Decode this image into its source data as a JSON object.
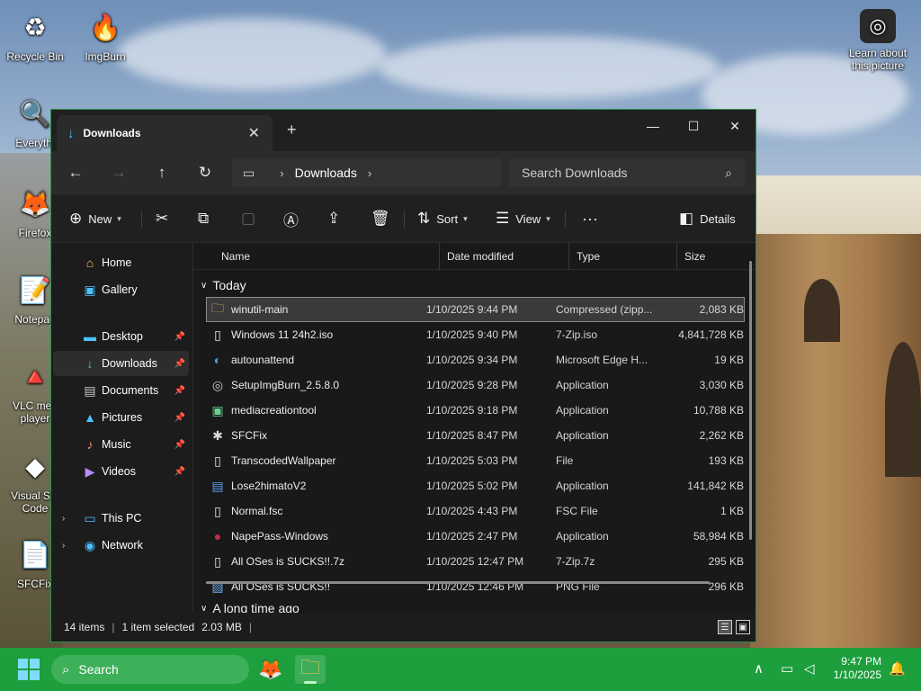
{
  "desktop": {
    "icons": [
      {
        "label": "Recycle Bin",
        "glyph": "♻"
      },
      {
        "label": "ImgBurn",
        "glyph": "🔥"
      },
      {
        "label": "Everythi",
        "glyph": "🔍"
      },
      {
        "label": "Firefox",
        "glyph": "🦊"
      },
      {
        "label": "Notepad",
        "glyph": "📝"
      },
      {
        "label": "VLC med player",
        "glyph": "🔺"
      },
      {
        "label": "Visual Stu Code",
        "glyph": "◆"
      },
      {
        "label": "SFCFix",
        "glyph": "📄"
      }
    ],
    "spotlight_label": "Learn about this picture"
  },
  "window": {
    "tab_title": "Downloads",
    "address": {
      "crumb": "Downloads"
    },
    "search_placeholder": "Search Downloads",
    "commands": {
      "new": "New",
      "sort": "Sort",
      "view": "View",
      "more": "···",
      "details": "Details"
    },
    "sidebar": {
      "top": [
        {
          "label": "Home",
          "glyph": "⌂",
          "color": "#f0c46a"
        },
        {
          "label": "Gallery",
          "glyph": "▣",
          "color": "#4cc2ff"
        }
      ],
      "pinned": [
        {
          "label": "Desktop",
          "glyph": "▬",
          "color": "#4cc2ff"
        },
        {
          "label": "Downloads",
          "glyph": "↓",
          "color": "#57d08a"
        },
        {
          "label": "Documents",
          "glyph": "▤",
          "color": "#c9c9c9"
        },
        {
          "label": "Pictures",
          "glyph": "▲",
          "color": "#4cc2ff"
        },
        {
          "label": "Music",
          "glyph": "♪",
          "color": "#ff8c6a"
        },
        {
          "label": "Videos",
          "glyph": "▶",
          "color": "#b58cff"
        }
      ],
      "bottom": [
        {
          "label": "This PC",
          "glyph": "▭",
          "color": "#4cc2ff"
        },
        {
          "label": "Network",
          "glyph": "◉",
          "color": "#4cc2ff"
        }
      ]
    },
    "columns": {
      "name": "Name",
      "date": "Date modified",
      "type": "Type",
      "size": "Size"
    },
    "group_today": "Today",
    "group_old": "A long time ago",
    "files": [
      {
        "name": "winutil-main",
        "date": "1/10/2025 9:44 PM",
        "type": "Compressed (zipp...",
        "size": "2,083 KB",
        "glyph": "🗀",
        "color": "#f3c75a",
        "selected": true
      },
      {
        "name": "Windows 11 24h2.iso",
        "date": "1/10/2025 9:40 PM",
        "type": "7-Zip.iso",
        "size": "4,841,728 KB",
        "glyph": "▯",
        "color": "#e8e8e8"
      },
      {
        "name": "autounattend",
        "date": "1/10/2025 9:34 PM",
        "type": "Microsoft Edge H...",
        "size": "19 KB",
        "glyph": "◐",
        "color": "#36a3e8"
      },
      {
        "name": "SetupImgBurn_2.5.8.0",
        "date": "1/10/2025 9:28 PM",
        "type": "Application",
        "size": "3,030 KB",
        "glyph": "◎",
        "color": "#c9c9c9"
      },
      {
        "name": "mediacreationtool",
        "date": "1/10/2025 9:18 PM",
        "type": "Application",
        "size": "10,788 KB",
        "glyph": "▣",
        "color": "#6ad08c"
      },
      {
        "name": "SFCFix",
        "date": "1/10/2025 8:47 PM",
        "type": "Application",
        "size": "2,262 KB",
        "glyph": "✱",
        "color": "#dcdcdc"
      },
      {
        "name": "TranscodedWallpaper",
        "date": "1/10/2025 5:03 PM",
        "type": "File",
        "size": "193 KB",
        "glyph": "▯",
        "color": "#e8e8e8"
      },
      {
        "name": "Lose2himatoV2",
        "date": "1/10/2025 5:02 PM",
        "type": "Application",
        "size": "141,842 KB",
        "glyph": "▤",
        "color": "#5aa0e8"
      },
      {
        "name": "Normal.fsc",
        "date": "1/10/2025 4:43 PM",
        "type": "FSC File",
        "size": "1 KB",
        "glyph": "▯",
        "color": "#e8e8e8"
      },
      {
        "name": "NapePass-Windows",
        "date": "1/10/2025 2:47 PM",
        "type": "Application",
        "size": "58,984 KB",
        "glyph": "●",
        "color": "#c0304a"
      },
      {
        "name": "All OSes is SUCKS!!.7z",
        "date": "1/10/2025 12:47 PM",
        "type": "7-Zip.7z",
        "size": "295 KB",
        "glyph": "▯",
        "color": "#e8e8e8"
      },
      {
        "name": "All OSes is SUCKS!!",
        "date": "1/10/2025 12:46 PM",
        "type": "PNG File",
        "size": "296 KB",
        "glyph": "▧",
        "color": "#6ab0f0"
      }
    ],
    "status": {
      "items": "14 items",
      "selected": "1 item selected",
      "size": "2.03 MB"
    }
  },
  "taskbar": {
    "search_label": "Search",
    "time": "9:47 PM",
    "date": "1/10/2025"
  }
}
